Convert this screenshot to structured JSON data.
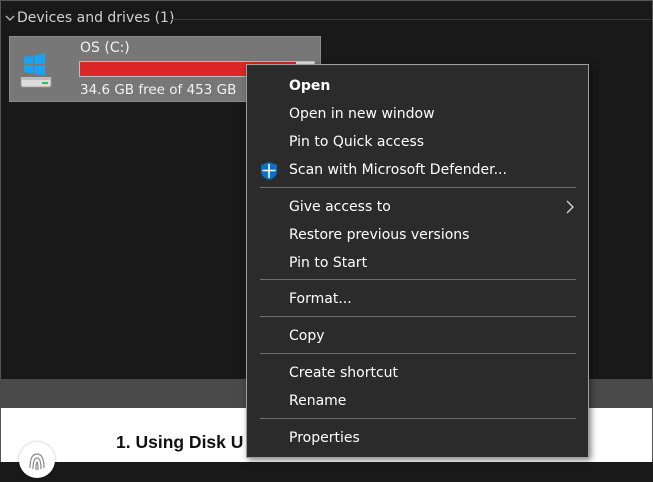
{
  "explorer": {
    "section_title": "Devices and drives (1)",
    "drive": {
      "name": "OS (C:)",
      "free_text": "34.6 GB free of 453 GB",
      "used_fraction": 0.924
    }
  },
  "context_menu": {
    "items": [
      {
        "label": "Open"
      },
      {
        "label": "Open in new window"
      },
      {
        "label": "Pin to Quick access"
      },
      {
        "label": "Scan with Microsoft Defender..."
      },
      {
        "label": "Give access to"
      },
      {
        "label": "Restore previous versions"
      },
      {
        "label": "Pin to Start"
      },
      {
        "label": "Format..."
      },
      {
        "label": "Copy"
      },
      {
        "label": "Create shortcut"
      },
      {
        "label": "Rename"
      },
      {
        "label": "Properties"
      }
    ]
  },
  "article": {
    "heading": "1. Using Disk U"
  },
  "colors": {
    "drive_bar_fill": "#da2626",
    "defender_blue": "#0b6fc7"
  }
}
